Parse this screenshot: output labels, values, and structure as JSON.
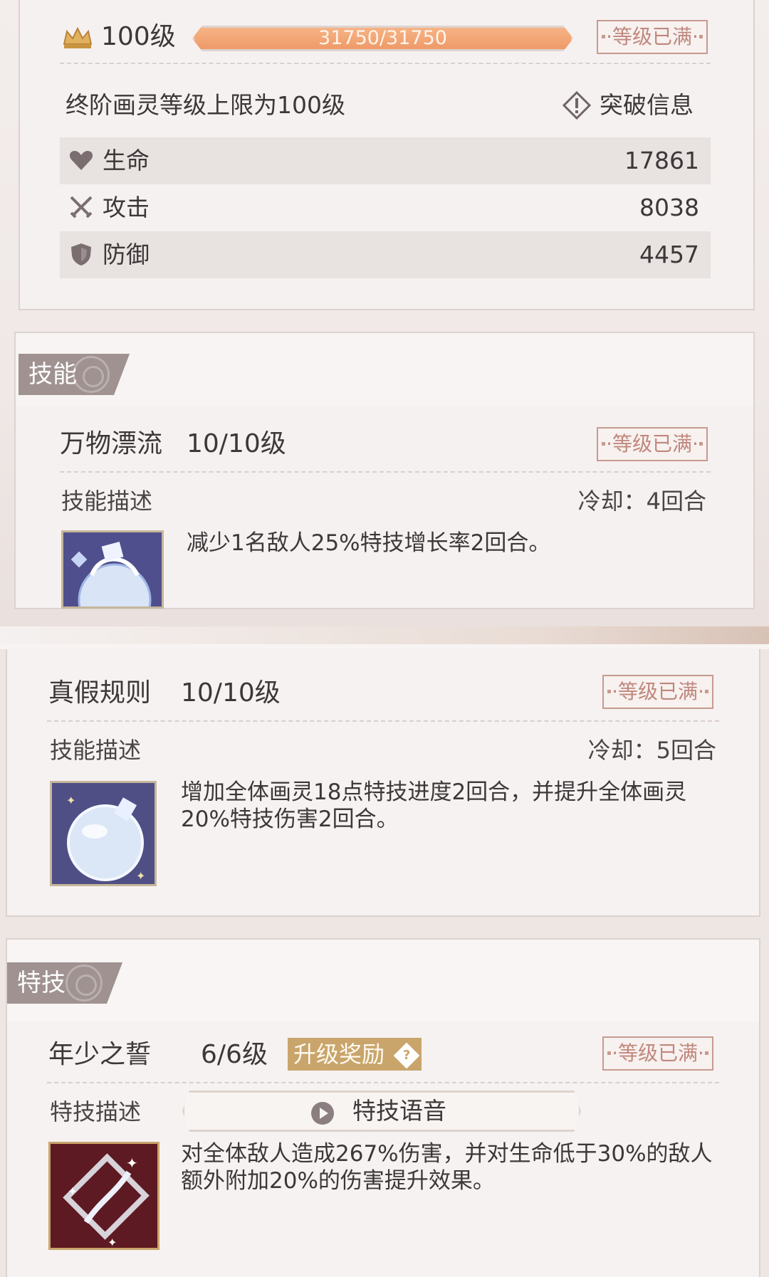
{
  "level": {
    "label": "100级",
    "exp_text": "31750/31750",
    "exp_fraction": 1.0,
    "max_badge": "·等级已满·"
  },
  "limit": {
    "text": "终阶画灵等级上限为100级",
    "breakthrough_label": "突破信息"
  },
  "stats": [
    {
      "icon": "heart-icon",
      "label": "生命",
      "value": "17861"
    },
    {
      "icon": "crossed-swords-icon",
      "label": "攻击",
      "value": "8038"
    },
    {
      "icon": "shield-icon",
      "label": "防御",
      "value": "4457"
    }
  ],
  "skills_section": {
    "tab_label": "技能",
    "skills": [
      {
        "name": "万物漂流",
        "level": "10/10级",
        "max_badge": "·等级已满·",
        "desc_label": "技能描述",
        "cooldown": "冷却：4回合",
        "description": "减少1名敌人25%特技增长率2回合。"
      },
      {
        "name": "真假规则",
        "level": "10/10级",
        "max_badge": "·等级已满·",
        "desc_label": "技能描述",
        "cooldown": "冷却：5回合",
        "description": "增加全体画灵18点特技进度2回合，并提升全体画灵20%特技伤害2回合。"
      }
    ]
  },
  "special_section": {
    "tab_label": "特技",
    "name": "年少之誓",
    "level": "6/6级",
    "upgrade_reward_label": "升级奖励",
    "max_badge": "·等级已满·",
    "desc_label": "特技描述",
    "voice_button_label": "特技语音",
    "description": "对全体敌人造成267%伤害，并对生命低于30%的敌人额外附加20%的伤害提升效果。"
  },
  "colors": {
    "exp_bar": "#f0a276",
    "max_badge": "#c0877d",
    "tab_bg": "#9f9291",
    "gold_tag": "#c9a56c"
  }
}
